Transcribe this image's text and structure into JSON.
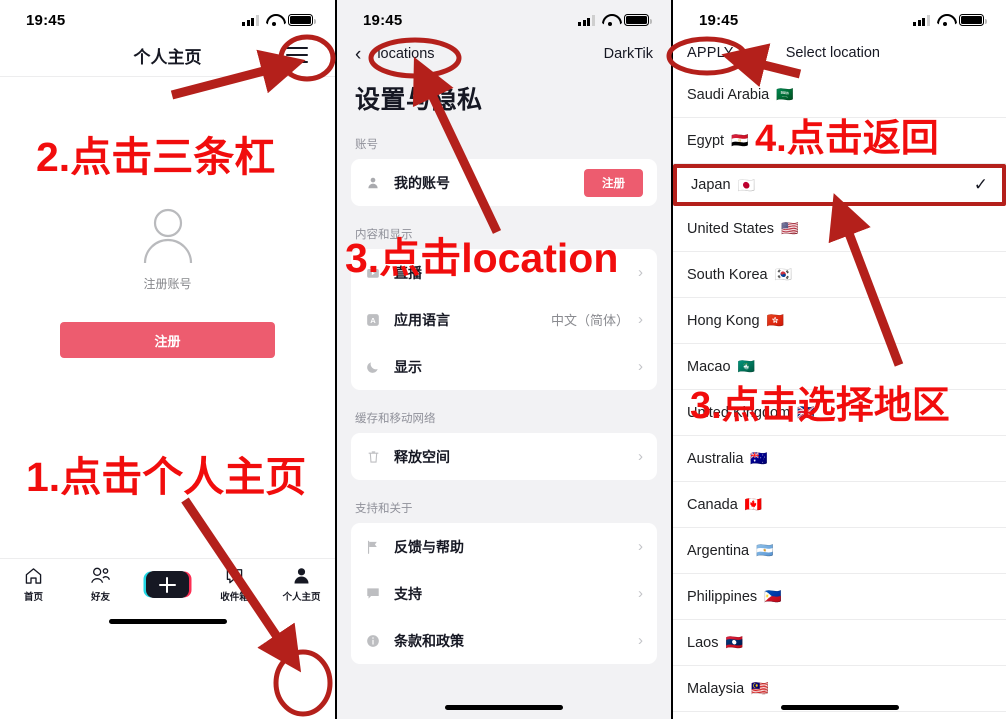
{
  "status_bar": {
    "time": "19:45",
    "signal_icon": "cellular-signal-icon",
    "wifi_icon": "wifi-icon",
    "battery_icon": "battery-icon"
  },
  "accent": {
    "tiktok_red": "#ed5c6f",
    "annotation_red": "#f10d0d",
    "highlight_red": "#b4201b"
  },
  "panel_profile": {
    "nav_title": "个人主页",
    "menu_icon": "hamburger-menu-icon",
    "avatar_icon": "person-avatar-icon",
    "avatar_label": "注册账号",
    "signup_button": "注册",
    "tabs": [
      {
        "label": "首页",
        "icon": "home-icon"
      },
      {
        "label": "好友",
        "icon": "friends-icon"
      },
      {
        "label": "",
        "icon": "create-plus-icon"
      },
      {
        "label": "收件箱",
        "icon": "inbox-icon"
      },
      {
        "label": "个人主页",
        "icon": "profile-person-icon"
      }
    ]
  },
  "panel_settings": {
    "back_icon": "chevron-left-icon",
    "breadcrumb": "locations",
    "brand": "DarkTik",
    "heading": "设置与隐私",
    "sections": [
      {
        "title": "账号",
        "rows": [
          {
            "label": "我的账号",
            "icon": "person-icon",
            "value": "",
            "action": "注册",
            "chevron": false
          }
        ]
      },
      {
        "title": "内容和显示",
        "rows": [
          {
            "label": "直播",
            "icon": "live-icon",
            "value": "",
            "action": "",
            "chevron": true
          },
          {
            "label": "应用语言",
            "icon": "language-icon",
            "value": "中文（简体）",
            "action": "",
            "chevron": true
          },
          {
            "label": "显示",
            "icon": "display-moon-icon",
            "value": "",
            "action": "",
            "chevron": true
          }
        ]
      },
      {
        "title": "缓存和移动网络",
        "rows": [
          {
            "label": "释放空间",
            "icon": "trash-icon",
            "value": "",
            "action": "",
            "chevron": true
          }
        ]
      },
      {
        "title": "支持和关于",
        "rows": [
          {
            "label": "反馈与帮助",
            "icon": "flag-icon",
            "value": "",
            "action": "",
            "chevron": true
          },
          {
            "label": "支持",
            "icon": "chat-icon",
            "value": "",
            "action": "",
            "chevron": true
          },
          {
            "label": "条款和政策",
            "icon": "info-icon",
            "value": "",
            "action": "",
            "chevron": true
          }
        ]
      }
    ]
  },
  "panel_locations": {
    "apply_button": "APPLY",
    "title": "Select location",
    "check_icon": "checkmark-icon",
    "rows": [
      {
        "name": "Saudi Arabia",
        "flag": "🇸🇦",
        "selected": false
      },
      {
        "name": "Egypt",
        "flag": "🇪🇬",
        "selected": false
      },
      {
        "name": "Japan",
        "flag": "🇯🇵",
        "selected": true
      },
      {
        "name": "United States",
        "flag": "🇺🇸",
        "selected": false
      },
      {
        "name": "South Korea",
        "flag": "🇰🇷",
        "selected": false
      },
      {
        "name": "Hong Kong",
        "flag": "🇭🇰",
        "selected": false
      },
      {
        "name": "Macao",
        "flag": "🇲🇴",
        "selected": false
      },
      {
        "name": "United Kingdom",
        "flag": "🇬🇧",
        "selected": false
      },
      {
        "name": "Australia",
        "flag": "🇦🇺",
        "selected": false
      },
      {
        "name": "Canada",
        "flag": "🇨🇦",
        "selected": false
      },
      {
        "name": "Argentina",
        "flag": "🇦🇷",
        "selected": false
      },
      {
        "name": "Philippines",
        "flag": "🇵🇭",
        "selected": false
      },
      {
        "name": "Laos",
        "flag": "🇱🇦",
        "selected": false
      },
      {
        "name": "Malaysia",
        "flag": "🇲🇾",
        "selected": false
      }
    ]
  },
  "annotations": [
    {
      "id": "step1",
      "text": "1.点击个人主页"
    },
    {
      "id": "step2",
      "text": "2.点击三条杠"
    },
    {
      "id": "step3",
      "text": "3.点击location"
    },
    {
      "id": "step4",
      "text": "4.点击返回"
    },
    {
      "id": "step3b",
      "text": "3.点击选择地区"
    }
  ]
}
